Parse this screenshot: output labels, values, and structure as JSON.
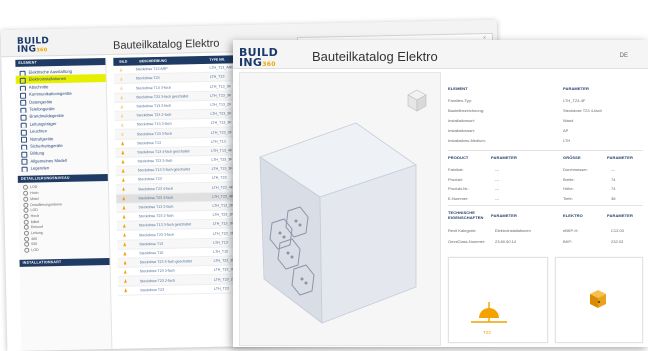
{
  "back": {
    "logo_top": "BUILD",
    "logo_bottom": "ING",
    "logo_suffix": "360",
    "title": "Bauteilkatalog Elektro",
    "search_close": "×",
    "sidebar_section": "ELEMENT",
    "sidebar_items": [
      {
        "label": "Elektrische Ausstattung",
        "active": false
      },
      {
        "label": "Elektroinstallationen",
        "active": true
      },
      {
        "label": "Abschnitte",
        "active": false
      },
      {
        "label": "Kommunikationsgeräte",
        "active": false
      },
      {
        "label": "Datengeräte",
        "active": false
      },
      {
        "label": "Telefongeräte",
        "active": false
      },
      {
        "label": "Brandmeldegeräte",
        "active": false
      },
      {
        "label": "Leitungsträger",
        "active": false
      },
      {
        "label": "Leuchten",
        "active": false
      },
      {
        "label": "Notrufgeräte",
        "active": false
      },
      {
        "label": "Sicherheitsgeräte",
        "active": false
      },
      {
        "label": "Bildung",
        "active": false
      },
      {
        "label": "Allgemeines Modell",
        "active": false
      },
      {
        "label": "Legenden",
        "active": false
      }
    ],
    "level_section": "DETAILLIERUNGSNIVEAU",
    "levels": [
      "LOD",
      "Hoch",
      "Mittel",
      "Detaillierungsebene",
      "LOD",
      "Hoch",
      "Mittel",
      "Entwurf",
      "Leitung",
      "400",
      "500",
      "LOD"
    ],
    "bottom_section": "INSTALLATIONSART",
    "table_headers": [
      "BILD",
      "BESCHREIBUNG",
      "TYPE NR."
    ],
    "rows": [
      {
        "desc": "Steckdose T13 ARP",
        "type": "LTH_T13_ARP"
      },
      {
        "desc": "Steckdose T23",
        "type": "LTH_T23"
      },
      {
        "desc": "Steckdose T13 3-fach",
        "type": "LTH_T13_3F"
      },
      {
        "desc": "Steckdose T23 3-fach geschaltet",
        "type": "LTH_T23_3F"
      },
      {
        "desc": "Steckdose T13 2-fach",
        "type": "LTH_T13_2F"
      },
      {
        "desc": "Steckdose T23 2-fach",
        "type": "LTH_T23_2F"
      },
      {
        "desc": "Steckdose T13 3-fach",
        "type": "LTH_T13_3F"
      },
      {
        "desc": "Steckdose T23 3-fach",
        "type": "LTH_T23_3F"
      },
      {
        "desc": "Steckdose T13",
        "type": "LTH_T13"
      },
      {
        "desc": "Steckdose T13 4-fach geschaltet",
        "type": "LTH_T13_4F"
      },
      {
        "desc": "Steckdose T23 3-fach",
        "type": "LTH_T23_3F"
      },
      {
        "desc": "Steckdose T13 3-fach geschaltet",
        "type": "LTH_T13_3F"
      },
      {
        "desc": "Steckdose T23",
        "type": "LTH_T23"
      },
      {
        "desc": "Steckdose T23 4-fach",
        "type": "LTH_T23_4F"
      },
      {
        "desc": "Steckdose T23 4-fach",
        "type": "LTH_T23_4F"
      },
      {
        "desc": "Steckdose T13 2-fach",
        "type": "LTH_T13_2F"
      },
      {
        "desc": "Steckdose T23 2-fach",
        "type": "LTH_T23_2F"
      },
      {
        "desc": "Steckdose T13 3-fach geschaltet",
        "type": "LTH_T13_3F"
      },
      {
        "desc": "Steckdose T23 3-fach",
        "type": "LTH_T23_3F"
      },
      {
        "desc": "Steckdose T13",
        "type": "LTH_T13"
      },
      {
        "desc": "Steckdose T15",
        "type": "LTH_T15"
      },
      {
        "desc": "Steckdose T23 3-fach geschaltet",
        "type": "LTH_T23_3F"
      },
      {
        "desc": "Steckdose T23 3-fach",
        "type": "LTH_T23_3F"
      },
      {
        "desc": "Steckdose T23 2-fach",
        "type": "LTH_T23_2F"
      },
      {
        "desc": "Steckdose T23",
        "type": "LTH_T23"
      }
    ]
  },
  "front": {
    "logo_top": "BUILD",
    "logo_bottom": "ING",
    "logo_suffix": "360",
    "title": "Bauteilkatalog Elektro",
    "lang": "DE",
    "element_header": "ELEMENT",
    "param_header": "PARAMETER",
    "element_rows": [
      {
        "label": "Familien-Typ:",
        "value": "LTH_T23-4F"
      },
      {
        "label": "Bauteilbezeichnung:",
        "value": "Steckdose T23 4-fach"
      },
      {
        "label": "Installationsort:",
        "value": "Wand"
      },
      {
        "label": "Installationsart:",
        "value": "AP"
      },
      {
        "label": "Installations-Medium:",
        "value": "LTH"
      }
    ],
    "product_header": "PRODUCT",
    "product_param": "PARAMETER",
    "size_header": "GRÖSSE",
    "size_param": "PARAMETER",
    "product_rows": [
      {
        "label": "Fabrikat:",
        "value": "---",
        "slabel": "Durchmesser:",
        "svalue": "---"
      },
      {
        "label": "Produkt:",
        "value": "---",
        "slabel": "Breite:",
        "svalue": "74"
      },
      {
        "label": "Produkt-Nr.:",
        "value": "---",
        "slabel": "Höhe:",
        "svalue": "74"
      },
      {
        "label": "E-Nummer:",
        "value": "---",
        "slabel": "Tiefe:",
        "svalue": "38"
      }
    ],
    "tech_header_1": "TECHNISCHE",
    "tech_header_2": "EIGENSCHAFTEN",
    "tech_param": "PARAMETER",
    "elektro_header": "ELEKTRO",
    "elektro_param": "PARAMETER",
    "tech_rows": [
      {
        "label": "Revit Kategorie:",
        "value": "Elektroinstallationen",
        "elabel": "eBKP-H:",
        "evalue": "C12.03"
      },
      {
        "label": "OmniClass-Nummer:",
        "value": "23.80.50.14",
        "elabel": "BKP:",
        "evalue": "232.03"
      }
    ],
    "icon_label": "T23"
  },
  "colors": {
    "navy": "#1f3b63",
    "accent_orange": "#f3a200",
    "highlight_yellow": "#e6ef00"
  }
}
